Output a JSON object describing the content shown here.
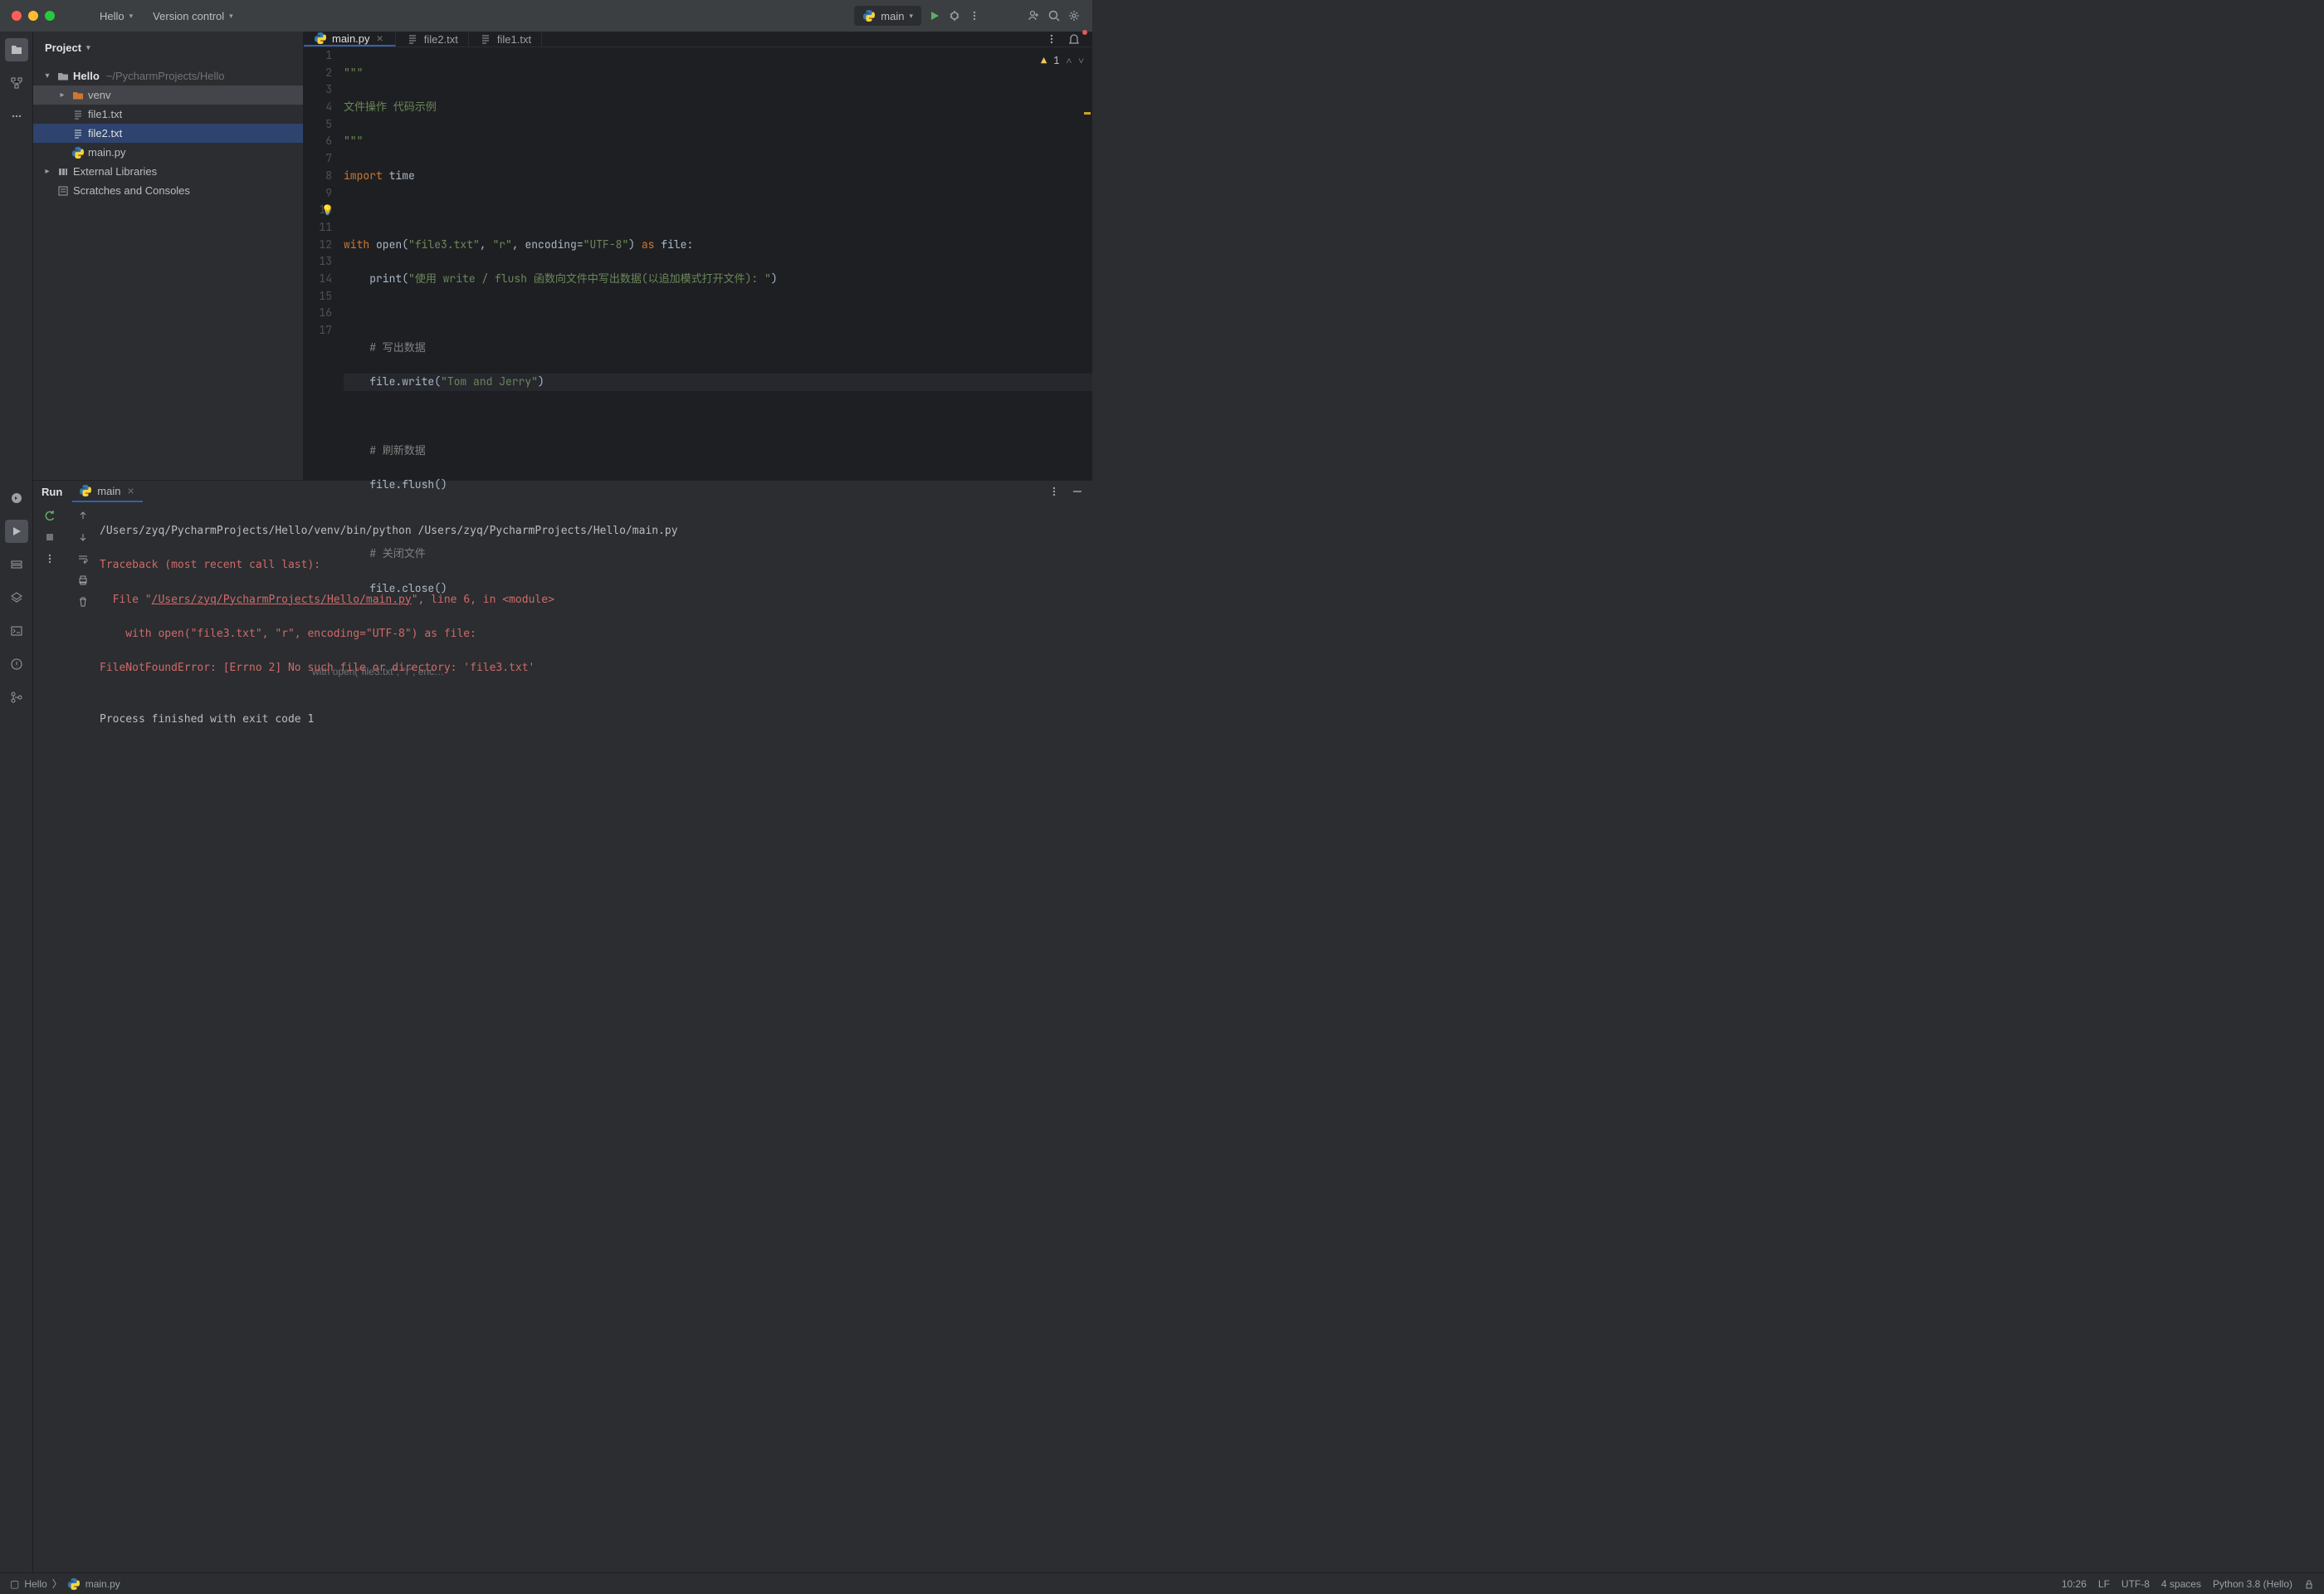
{
  "titlebar": {
    "project": "Hello",
    "vcs": "Version control",
    "branch": "main"
  },
  "project_view": {
    "title": "Project",
    "root": {
      "name": "Hello",
      "path": "~/PycharmProjects/Hello"
    },
    "venv": "venv",
    "file1": "file1.txt",
    "file2": "file2.txt",
    "mainpy": "main.py",
    "extlib": "External Libraries",
    "scratch": "Scratches and Consoles"
  },
  "tabs": {
    "t0": "main.py",
    "t1": "file2.txt",
    "t2": "file1.txt"
  },
  "inspection": {
    "warn_count": "1"
  },
  "code": {
    "l1": "\"\"\"",
    "l2": "文件操作 代码示例",
    "l3": "\"\"\"",
    "l4_a": "import",
    "l4_b": " time",
    "l6_a": "with",
    "l6_b": " open(",
    "l6_c": "\"file3.txt\"",
    "l6_d": ", ",
    "l6_e": "\"r\"",
    "l6_f": ", encoding=",
    "l6_g": "\"UTF-8\"",
    "l6_h": ") ",
    "l6_i": "as",
    "l6_j": " file:",
    "l7_a": "    print(",
    "l7_b": "\"使用 write / flush 函数向文件中写出数据(以追加模式打开文件): \"",
    "l7_c": ")",
    "l9": "    # 写出数据",
    "l10_a": "    file.write(",
    "l10_b": "\"Tom and Jerry\"",
    "l10_c": ")",
    "l12": "    # 刷新数据",
    "l13": "    file.flush()",
    "l15": "    # 关闭文件",
    "l16": "    file.close()"
  },
  "breadcrumb": "with open(\"file3.txt\", \"r\", enc…",
  "run": {
    "title": "Run",
    "tab": "main",
    "out1": "/Users/zyq/PycharmProjects/Hello/venv/bin/python /Users/zyq/PycharmProjects/Hello/main.py",
    "out2": "Traceback (most recent call last):",
    "out3a": "  File \"",
    "out3b": "/Users/zyq/PycharmProjects/Hello/main.py",
    "out3c": "\", line 6, in <module>",
    "out4": "    with open(\"file3.txt\", \"r\", encoding=\"UTF-8\") as file:",
    "out5": "FileNotFoundError: [Errno 2] No such file or directory: 'file3.txt'",
    "out6": "",
    "out7": "Process finished with exit code 1"
  },
  "status": {
    "crumb_proj": "Hello",
    "crumb_file": "main.py",
    "pos": "10:26",
    "sep": "LF",
    "enc": "UTF-8",
    "indent": "4 spaces",
    "sdk": "Python 3.8 (Hello)"
  }
}
